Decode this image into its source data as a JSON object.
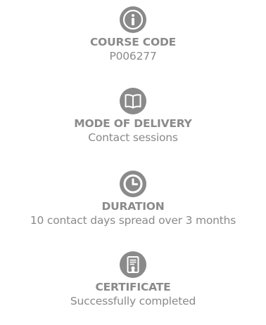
{
  "items": [
    {
      "icon": "info-icon",
      "label": "COURSE CODE",
      "value": "P006277"
    },
    {
      "icon": "book-icon",
      "label": "MODE OF DELIVERY",
      "value": "Contact sessions"
    },
    {
      "icon": "clock-icon",
      "label": "DURATION",
      "value": "10 contact days spread over 3 months"
    },
    {
      "icon": "certificate-icon",
      "label": "CERTIFICATE",
      "value": "Successfully completed"
    }
  ],
  "colors": {
    "icon": "#8a8a8a",
    "text": "#8a8a8a",
    "background": "#ffffff"
  }
}
